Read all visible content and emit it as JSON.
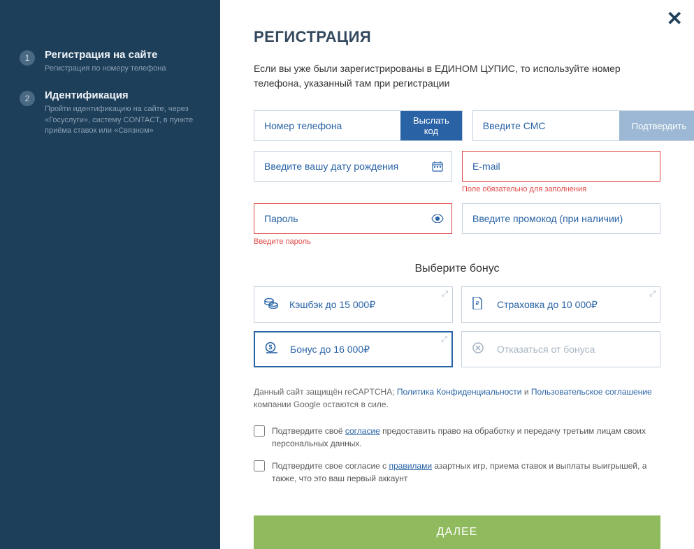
{
  "sidebar": {
    "steps": [
      {
        "num": "1",
        "title": "Регистрация на сайте",
        "sub": "Регистрация по номеру телефона"
      },
      {
        "num": "2",
        "title": "Идентификация",
        "sub": "Пройти идентификацию на сайте, через «Госуслуги», систему CONTACT, в пункте приёма ставок или «Связном»"
      }
    ]
  },
  "heading": "РЕГИСТРАЦИЯ",
  "intro": "Если вы уже были зарегистрированы в ЕДИНОМ ЦУПИС, то используйте номер телефона, указанный там при регистрации",
  "fields": {
    "phone": {
      "placeholder": "Номер телефона",
      "button": "Выслать код"
    },
    "sms": {
      "placeholder": "Введите СМС",
      "button": "Подтвердить"
    },
    "dob": {
      "placeholder": "Введите вашу дату рождения"
    },
    "email": {
      "placeholder": "E-mail",
      "error": "Поле обязательно для заполнения"
    },
    "password": {
      "placeholder": "Пароль",
      "error": "Введите пароль"
    },
    "promo": {
      "placeholder": "Введите промокод (при наличии)"
    }
  },
  "bonus": {
    "title": "Выберите бонус",
    "options": [
      {
        "label": "Кэшбэк до 15 000₽"
      },
      {
        "label": "Страховка до 10 000₽"
      },
      {
        "label": "Бонус до 16 000₽"
      },
      {
        "label": "Отказаться от бонуса"
      }
    ]
  },
  "recaptcha": {
    "pre": "Данный сайт защищён reCAPTCHA; ",
    "link1": "Политика Конфиденциальности",
    "mid": " и ",
    "link2": "Пользовательское соглашение",
    "post": " компании Google остаются в силе."
  },
  "consent": {
    "c1_pre": "Подтвердите своё ",
    "c1_link": "согласие",
    "c1_post": " предоставить право на обработку и передачу третьим лицам своих персональных данных.",
    "c2_pre": "Подтвердите свое согласие с ",
    "c2_link": "правилами",
    "c2_post": " азартных игр, приема ставок и выплаты выигрышей, а также, что это ваш первый аккаунт"
  },
  "submit": "ДАЛЕЕ"
}
